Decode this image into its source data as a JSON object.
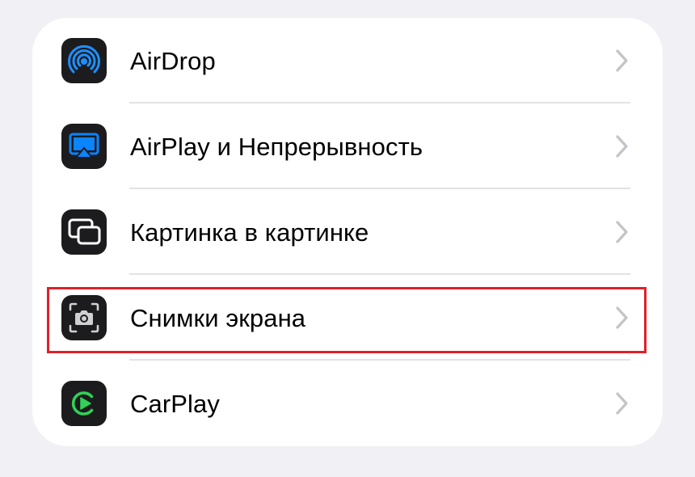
{
  "settings": {
    "items": [
      {
        "label": "AirDrop",
        "icon": "airdrop-icon"
      },
      {
        "label": "AirPlay и Непрерывность",
        "icon": "airplay-icon"
      },
      {
        "label": "Картинка в картинке",
        "icon": "picture-in-picture-icon"
      },
      {
        "label": "Снимки экрана",
        "icon": "screenshot-camera-icon"
      },
      {
        "label": "CarPlay",
        "icon": "carplay-icon"
      }
    ],
    "highlighted_item": "Снимки экрана"
  },
  "colors": {
    "page_background": "#f0f0f5",
    "card_background": "#ffffff",
    "icon_background": "#1c1c1e",
    "airdrop_accent": "#1e90ff",
    "airplay_accent": "#0a84ff",
    "carplay_accent": "#30d158",
    "highlight_border": "#e0202a",
    "chevron": "#c4c4c7"
  }
}
